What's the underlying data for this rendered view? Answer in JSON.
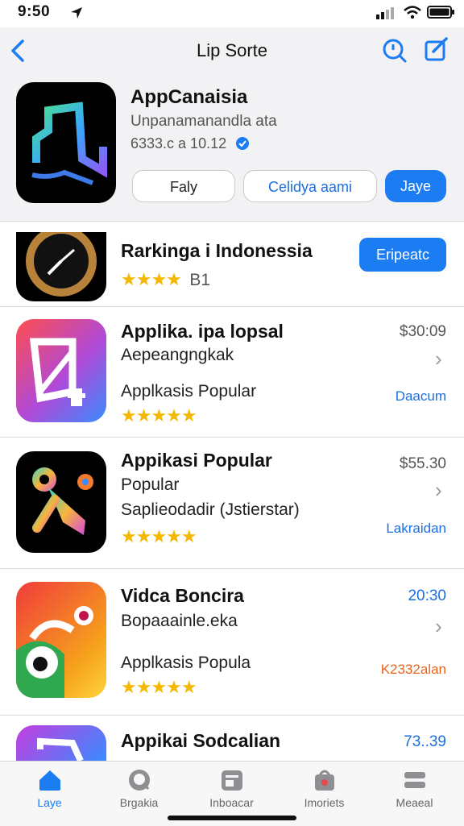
{
  "status": {
    "time": "9:50"
  },
  "nav": {
    "title": "Lip Sorte",
    "back_icon": "chevron-left-icon",
    "search_icon": "search-icon",
    "compose_icon": "compose-icon"
  },
  "featured": {
    "title": "AppCanaisia",
    "subtitle": "Unpanamanandla ata",
    "meta": "6333.c a 10.12",
    "buttons": [
      "Faly",
      "Celidya aami",
      "Jaye"
    ]
  },
  "ranking": {
    "title": "Rarkinga i Indonessia",
    "rating_text": "B1",
    "button": "Eripeatc"
  },
  "apps": [
    {
      "title": "Applika. ipa lopsal",
      "subtitle": "Aepeangngkak",
      "desc": "Applkasis Popular",
      "price": "$30:09",
      "tag": "Daacum",
      "tag_color": "#1c6fe3"
    },
    {
      "title": "Appikasi Popular",
      "subtitle": "Popular",
      "desc": "Saplieodadir (Jstierstar)",
      "price": "$55.30",
      "tag": "Lakraidan",
      "tag_color": "#1c6fe3"
    },
    {
      "title": "Vidca Boncira",
      "subtitle": "Bopaaainle.eka",
      "desc": "Applkasis Popula",
      "price": "20:30",
      "tag": "K2332alan",
      "tag_color": "#e8641b",
      "price_color": "#1c6fe3"
    },
    {
      "title": "Appikai Sodcalian",
      "price": "73..39",
      "price_color": "#1c6fe3"
    }
  ],
  "tabs": [
    {
      "label": "Laye",
      "icon": "home-icon",
      "active": true
    },
    {
      "label": "Brgakia",
      "icon": "search-icon",
      "active": false
    },
    {
      "label": "Inboacar",
      "icon": "apps-icon",
      "active": false
    },
    {
      "label": "Imoriets",
      "icon": "bag-icon",
      "active": false
    },
    {
      "label": "Meaeal",
      "icon": "grid-icon",
      "active": false
    }
  ],
  "colors": {
    "accent": "#1c7cf2",
    "star": "#f5b800"
  }
}
